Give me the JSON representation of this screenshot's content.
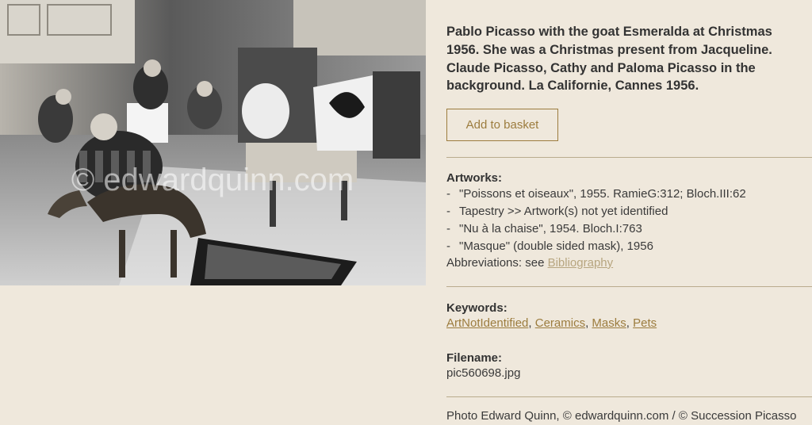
{
  "photo": {
    "watermark": "© edwardquinn.com"
  },
  "caption": "Pablo Picasso with the goat Esmeralda at Christmas 1956. She was a Christmas present from Jacqueline. Claude Picasso, Cathy and Paloma Picasso in the background. La Californie, Cannes 1956.",
  "add_to_basket_label": "Add to basket",
  "artworks": {
    "heading": "Artworks:",
    "items": [
      {
        "dash": "-",
        "text": "\"Poissons et oiseaux\", 1955. RamieG:312; Bloch.III:62"
      },
      {
        "dash": "-",
        "text": "Tapestry >> Artwork(s) not yet identified"
      },
      {
        "dash": "-",
        "text": "\"Nu à la chaise\", 1954. Bloch.I:763"
      },
      {
        "dash": "-",
        "text": "\"Masque\" (double sided mask), 1956"
      }
    ],
    "abbrev_prefix": "Abbreviations: see ",
    "abbrev_link": "Bibliography"
  },
  "keywords": {
    "heading": "Keywords:",
    "items": [
      "ArtNotIdentified",
      "Ceramics",
      "Masks",
      "Pets"
    ],
    "separator": ", "
  },
  "filename": {
    "heading": "Filename:",
    "value": "pic560698.jpg"
  },
  "credit": "Photo Edward Quinn, © edwardquinn.com / © Succession Picasso",
  "colors": {
    "background": "#efe8dc",
    "accent": "#9c7c3e",
    "link_muted": "#b7a57f",
    "divider": "#b9ab8d"
  }
}
